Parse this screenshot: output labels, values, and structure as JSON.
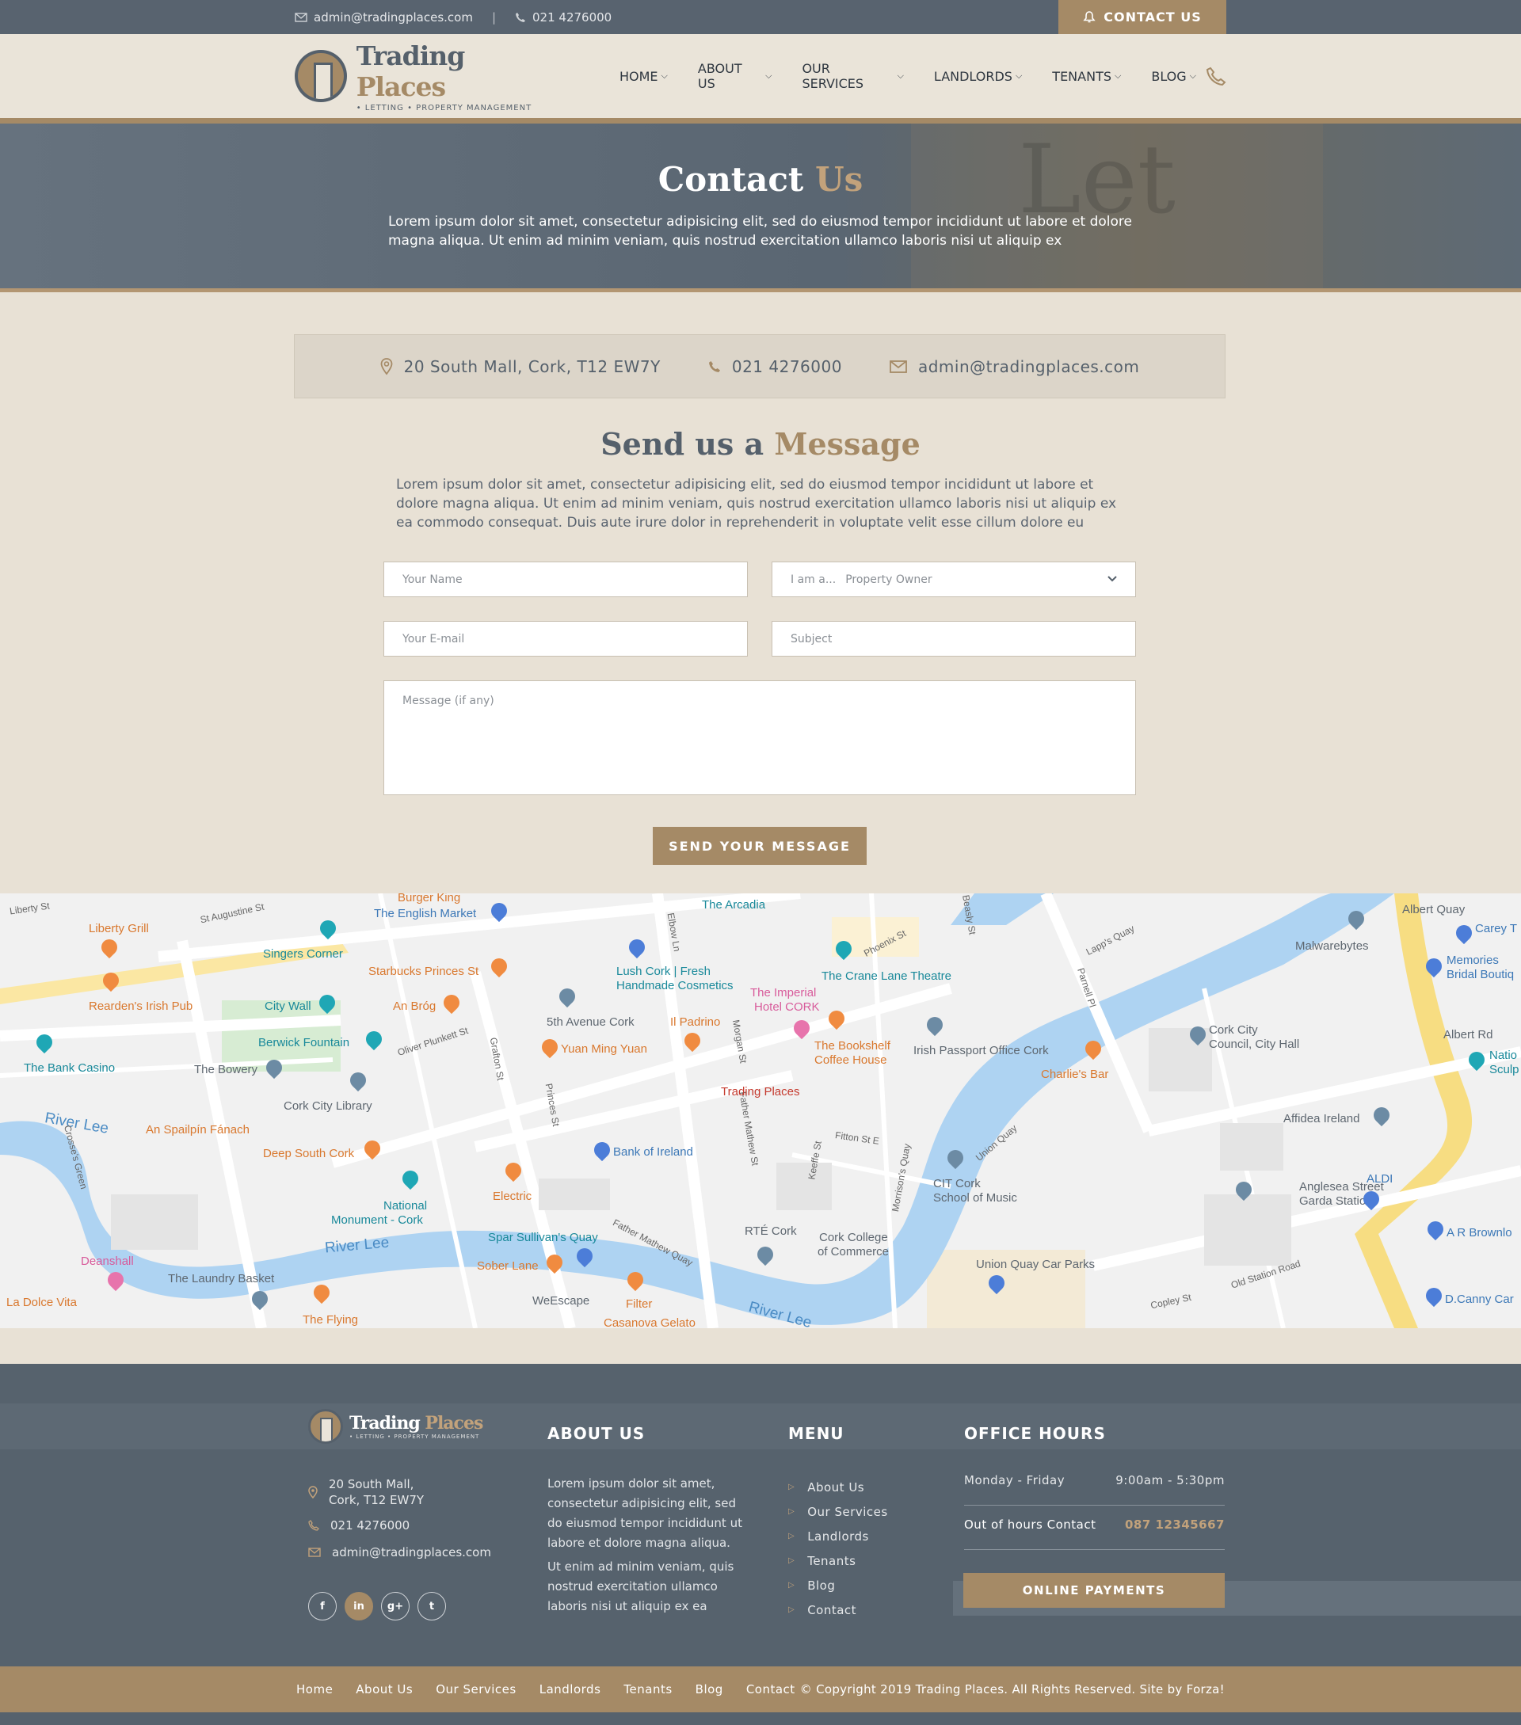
{
  "topbar": {
    "email": "admin@tradingplaces.com",
    "separator": "|",
    "phone": "021 4276000",
    "contact_button": "CONTACT US"
  },
  "brand": {
    "name_part1": "Trading",
    "name_part2": "Places",
    "tagline": "• LETTING   • PROPERTY MANAGEMENT"
  },
  "nav": {
    "items": [
      {
        "label": "HOME"
      },
      {
        "label": "ABOUT US"
      },
      {
        "label": "OUR SERVICES"
      },
      {
        "label": "LANDLORDS"
      },
      {
        "label": "TENANTS"
      },
      {
        "label": "BLOG"
      }
    ]
  },
  "hero": {
    "title_part1": "Contact",
    "title_part2": "Us",
    "text": "Lorem ipsum dolor sit amet, consectetur adipisicing elit, sed do eiusmod tempor incididunt ut labore et dolore magna aliqua. Ut enim ad minim veniam, quis nostrud exercitation ullamco laboris nisi ut aliquip ex",
    "bg_text": "Let"
  },
  "info": {
    "address": "20 South Mall, Cork, T12 EW7Y",
    "phone": "021 4276000",
    "email": "admin@tradingplaces.com"
  },
  "message": {
    "title_part1": "Send us a",
    "title_part2": "Message",
    "text": "Lorem ipsum dolor sit amet, consectetur adipisicing elit, sed do eiusmod tempor incididunt ut labore et dolore magna aliqua. Ut enim ad minim veniam, quis nostrud exercitation ullamco laboris nisi ut aliquip ex ea commodo consequat. Duis aute irure dolor in reprehenderit in voluptate velit esse cillum dolore eu"
  },
  "form": {
    "name_placeholder": "Your Name",
    "role_prefix": "I am a...",
    "role_value": "Property Owner",
    "email_placeholder": "Your E-mail",
    "subject_placeholder": "Subject",
    "message_placeholder": "Message (if any)",
    "submit": "SEND YOUR MESSAGE"
  },
  "map": {
    "marker_label": "Trading Places",
    "labels": {
      "burger_king": "Burger King",
      "english_market": "The English Market",
      "liberty_grill": "Liberty Grill",
      "singers_corner": "Singers Corner",
      "starbucks": "Starbucks Princes St",
      "lush": "Lush Cork | Fresh",
      "lush2": "Handmade Cosmetics",
      "arcadia": "The Arcadia",
      "crane_lane": "The Crane Lane Theatre",
      "imperial": "The Imperial",
      "imperial2": "Hotel CORK",
      "rearden": "Rearden's Irish Pub",
      "city_wall": "City Wall",
      "an_brog": "An Bróg",
      "fifth_ave": "5th Avenue Cork",
      "il_padrino": "Il Padrino",
      "bookshelf": "The Bookshelf",
      "bookshelf2": "Coffee House",
      "passport": "Irish Passport Office Cork",
      "berwick": "Berwick Fountain",
      "bank_casino": "The Bank Casino",
      "bowery": "The Bowery",
      "yuan_ming": "Yuan Ming Yuan",
      "charlies": "Charlie's Bar",
      "city_library": "Cork City Library",
      "an_spailpin": "An Spailpín Fánach",
      "deep_south": "Deep South Cork",
      "bank_ireland": "Bank of Ireland",
      "national": "National",
      "national2": "Monument - Cork",
      "electric": "Electric",
      "cit": "CIT Cork",
      "cit2": "School of Music",
      "anglesea": "Anglesea Street",
      "anglesea2": "Garda Station",
      "aldi": "ALDI",
      "affidea": "Affidea Ireland",
      "malwarebytes": "Malwarebytes",
      "albert_quay": "Albert Quay",
      "carey": "Carey T",
      "memories": "Memories",
      "memories2": "Bridal Boutiq",
      "city_council": "Cork City",
      "city_council2": "Council, City Hall",
      "albert_rd": "Albert Rd",
      "natio": "Natio",
      "sculp": "Sculp",
      "spar": "Spar Sullivan's Quay",
      "sober_lane": "Sober Lane",
      "rte": "RTÉ Cork",
      "cork_college": "Cork College",
      "cork_college2": "of Commerce",
      "union_quay": "Union Quay Car Parks",
      "laundry": "The Laundry Basket",
      "deanshall": "Deanshall",
      "la_dolce": "La Dolce Vita",
      "the_flying": "The Flying",
      "wescape": "WeEscape",
      "filter": "Filter",
      "casanova": "Casanova Gelato",
      "a_r_brownlow": "A R Brownlo",
      "d_canny": "D.Canny Car",
      "river_lee_1": "River Lee",
      "river_lee_2": "River Lee",
      "river_lee_3": "River Lee",
      "liberty_st": "Liberty St",
      "st_augustine": "St Augustine St",
      "oliver_plunkett": "Oliver Plunkett St",
      "grafton": "Grafton St",
      "princes": "Princes St",
      "morgan": "Morgan St",
      "father_mathew": "Father Mathew St",
      "fitton": "Fitton St E",
      "keeffe": "Keeffe St",
      "morrisons": "Morrison's Quay",
      "lapps": "Lapp's Quay",
      "parnell": "Parnell Pl",
      "union_quay_rd": "Union Quay",
      "old_station": "Old Station Road",
      "copley": "Copley St",
      "father_mathew_quay": "Father Mathew Quay",
      "crosses_green": "Crosse's Green",
      "elbow": "Elbow Ln",
      "beasly": "Beasly St",
      "phoenix": "Phoenix St"
    }
  },
  "footer": {
    "address_line1": "20 South Mall,",
    "address_line2": "Cork, T12 EW7Y",
    "phone": "021 4276000",
    "email": "admin@tradingplaces.com",
    "about_title": "ABOUT US",
    "about_p1": "Lorem ipsum dolor sit amet, consectetur adipisicing elit, sed do eiusmod tempor incididunt ut labore et dolore magna aliqua.",
    "about_p2": "Ut enim ad minim veniam, quis nostrud exercitation ullamco laboris nisi ut aliquip ex ea",
    "menu_title": "MENU",
    "menu": [
      {
        "label": "About Us"
      },
      {
        "label": "Our Services"
      },
      {
        "label": "Landlords"
      },
      {
        "label": "Tenants"
      },
      {
        "label": "Blog"
      },
      {
        "label": "Contact"
      }
    ],
    "hours_title": "OFFICE HOURS",
    "hours_days": "Monday - Friday",
    "hours_time": "9:00am - 5:30pm",
    "out_of_hours_label": "Out of hours Contact",
    "out_of_hours_phone": "087 12345667",
    "payments": "ONLINE PAYMENTS",
    "social": [
      "f",
      "in",
      "g+",
      "t"
    ]
  },
  "bottom": {
    "links": [
      {
        "label": "Home"
      },
      {
        "label": "About Us"
      },
      {
        "label": "Our Services"
      },
      {
        "label": "Landlords"
      },
      {
        "label": "Tenants"
      },
      {
        "label": "Blog"
      },
      {
        "label": "Contact"
      }
    ],
    "copyright": "© Copyright 2019 Trading Places.  All Rights Reserved.  Site by Forza!"
  },
  "colors": {
    "brand_gold": "#a58a66",
    "slate": "#56626d",
    "cream": "#e8e1d5"
  }
}
